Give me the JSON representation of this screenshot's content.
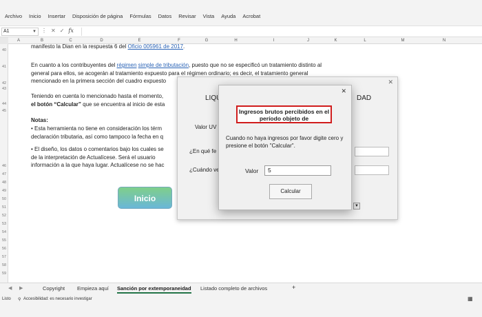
{
  "ribbon": {
    "tabs": [
      "Archivo",
      "Inicio",
      "Insertar",
      "Disposición de página",
      "Fórmulas",
      "Datos",
      "Revisar",
      "Vista",
      "Ayuda",
      "Acrobat"
    ]
  },
  "formula_bar": {
    "cell_ref": "A1",
    "fx": "fx"
  },
  "columns": [
    "A",
    "B",
    "C",
    "D",
    "E",
    "F",
    "G",
    "H",
    "I",
    "J",
    "K",
    "L",
    "M",
    "N"
  ],
  "rows": [
    "40",
    "41",
    "42",
    "43",
    "44",
    "45",
    "46",
    "47",
    "48",
    "49",
    "50",
    "51",
    "52",
    "53",
    "54",
    "55",
    "56",
    "57",
    "58",
    "59"
  ],
  "sheet": {
    "line1_a": "manifesto la Dian en la respuesta 6 del ",
    "line1_link": "Oficio 005961 de 2017",
    "line1_b": ".",
    "p2_a": "En cuanto a los contribuyentes del ",
    "p2_link1": "régimen",
    "p2_link2": "simple de tributación",
    "p2_b": ", puesto que no se especificó un tratamiento distinto al",
    "p2_line2": "general para ellos, se acogerán al tratamiento expuesto para el régimen ordinario; es decir, el tratamiento general",
    "p2_line3": "mencionado en la primera sección del cuadro expuesto",
    "p3_line1": "Teniendo en cuenta lo mencionado hasta el momento,",
    "p3_line2_bold": "el botón “Calcular”",
    "p3_line2": " que se encuentra al inicio de esta",
    "notas": "Notas:",
    "n1_line1": "• Esta herramienta no tiene en consideración los térm",
    "n1_line2": "declaración tributaria, así como tampoco la fecha en q",
    "n2_line1": "• El diseño, los datos o comentarios bajo los cuales se",
    "n2_line2": "de la interpretación de Actualícese. Será el usuario",
    "n2_line3": "información a la que haya lugar. Actualícese no se hac",
    "inicio_button": "Inicio"
  },
  "background_form": {
    "title": "LIQU",
    "title_right": "DAD",
    "label_valor": "Valor UV",
    "label_fecha": "¿En qué fe",
    "label_cuando": "¿Cuándo ve",
    "close": "✕"
  },
  "dialog": {
    "close": "✕",
    "heading": "Ingresos brutos percibidos en el período objeto de",
    "help": "Cuando no haya ingresos por favor digite cero y presione el botón \"Calcular\".",
    "value_label": "Valor",
    "value": "5",
    "calculate_button": "Calcular"
  },
  "sheet_tabs": {
    "tabs": [
      "Copyright",
      "Empieza aquí",
      "Sanción por extemporaneidad",
      "Listado completo de archivos"
    ],
    "active": "Sanción por extemporaneidad",
    "add": "+"
  },
  "status": {
    "ready": "Listo",
    "accessibility": "Accesibilidad: es necesario investigar"
  }
}
